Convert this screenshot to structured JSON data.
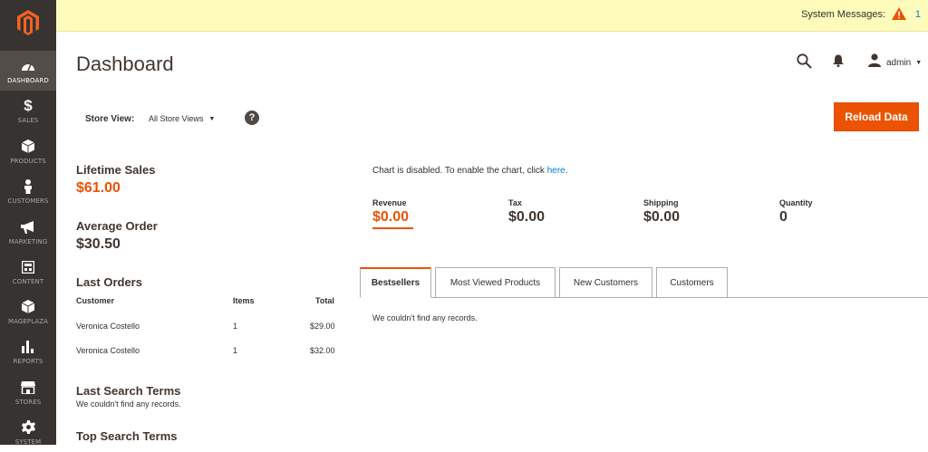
{
  "sidebar": {
    "items": [
      {
        "label": "DASHBOARD",
        "icon": "dashboard-icon"
      },
      {
        "label": "SALES",
        "icon": "dollar-icon"
      },
      {
        "label": "PRODUCTS",
        "icon": "cube-icon"
      },
      {
        "label": "CUSTOMERS",
        "icon": "person-icon"
      },
      {
        "label": "MARKETING",
        "icon": "megaphone-icon"
      },
      {
        "label": "CONTENT",
        "icon": "layout-icon"
      },
      {
        "label": "MAGEPLAZA",
        "icon": "box-icon"
      },
      {
        "label": "REPORTS",
        "icon": "bar-chart-icon"
      },
      {
        "label": "STORES",
        "icon": "store-icon"
      },
      {
        "label": "SYSTEM",
        "icon": "gear-icon"
      }
    ]
  },
  "system_messages": {
    "label": "System Messages:",
    "count": "1"
  },
  "header": {
    "title": "Dashboard",
    "user": "admin"
  },
  "store_view": {
    "label": "Store View:",
    "value": "All Store Views"
  },
  "help": "?",
  "reload_button": "Reload Data",
  "lifetime_sales": {
    "label": "Lifetime Sales",
    "value": "$61.00"
  },
  "average_order": {
    "label": "Average Order",
    "value": "$30.50"
  },
  "last_orders": {
    "title": "Last Orders",
    "columns": [
      "Customer",
      "Items",
      "Total"
    ],
    "rows": [
      {
        "customer": "Veronica Costello",
        "items": "1",
        "total": "$29.00"
      },
      {
        "customer": "Veronica Costello",
        "items": "1",
        "total": "$32.00"
      }
    ]
  },
  "last_search_terms": {
    "title": "Last Search Terms",
    "empty": "We couldn't find any records."
  },
  "top_search_terms": {
    "title": "Top Search Terms"
  },
  "chart_note": {
    "text": "Chart is disabled. To enable the chart, click ",
    "link": "here",
    "suffix": "."
  },
  "stats": [
    {
      "label": "Revenue",
      "value": "$0.00"
    },
    {
      "label": "Tax",
      "value": "$0.00"
    },
    {
      "label": "Shipping",
      "value": "$0.00"
    },
    {
      "label": "Quantity",
      "value": "0"
    }
  ],
  "tabs": [
    "Bestsellers",
    "Most Viewed Products",
    "New Customers",
    "Customers"
  ],
  "tab_content": "We couldn't find any records.",
  "colors": {
    "accent": "#eb5202",
    "sidebar": "#373330",
    "link": "#007bdb"
  }
}
